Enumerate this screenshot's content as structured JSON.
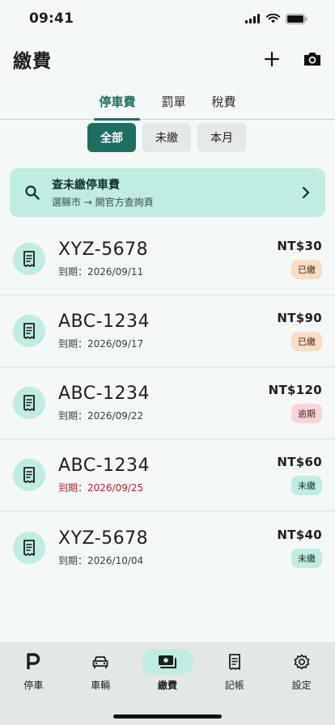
{
  "status": {
    "time": "09:41"
  },
  "header": {
    "title": "繳費",
    "add_icon": "plus-icon",
    "camera_icon": "camera-icon"
  },
  "tabs": [
    {
      "label": "停車費",
      "active": true
    },
    {
      "label": "罰單",
      "active": false
    },
    {
      "label": "稅費",
      "active": false
    }
  ],
  "filters": [
    {
      "label": "全部",
      "active": true
    },
    {
      "label": "未繳",
      "active": false
    },
    {
      "label": "本月",
      "active": false
    }
  ],
  "search_card": {
    "title": "查未繳停車費",
    "subtitle": "選縣市 → 開官方查詢頁",
    "icon": "search-icon"
  },
  "payments": [
    {
      "plate": "XYZ-5678",
      "due_label": "到期：",
      "due_date": "2026/09/11",
      "amount": "NT$30",
      "status": "已繳",
      "status_type": "paid",
      "overdue": false
    },
    {
      "plate": "ABC-1234",
      "due_label": "到期：",
      "due_date": "2026/09/17",
      "amount": "NT$90",
      "status": "已繳",
      "status_type": "paid",
      "overdue": false
    },
    {
      "plate": "ABC-1234",
      "due_label": "到期：",
      "due_date": "2026/09/22",
      "amount": "NT$120",
      "status": "逾期",
      "status_type": "late",
      "overdue": false
    },
    {
      "plate": "ABC-1234",
      "due_label": "到期：",
      "due_date": "2026/09/25",
      "amount": "NT$60",
      "status": "未繳",
      "status_type": "unpaid",
      "overdue": true
    },
    {
      "plate": "XYZ-5678",
      "due_label": "到期：",
      "due_date": "2026/10/04",
      "amount": "NT$40",
      "status": "未繳",
      "status_type": "unpaid",
      "overdue": false
    }
  ],
  "bottom_nav": [
    {
      "label": "停車",
      "icon": "parking-icon",
      "active": false
    },
    {
      "label": "車輛",
      "icon": "car-icon",
      "active": false
    },
    {
      "label": "繳費",
      "icon": "payment-icon",
      "active": true
    },
    {
      "label": "記帳",
      "icon": "receipt-icon",
      "active": false
    },
    {
      "label": "設定",
      "icon": "gear-icon",
      "active": false
    }
  ],
  "colors": {
    "accent": "#1d6f62",
    "accent_light": "#bfece3",
    "background": "#f4f8f7",
    "overdue_text": "#b3262d"
  }
}
